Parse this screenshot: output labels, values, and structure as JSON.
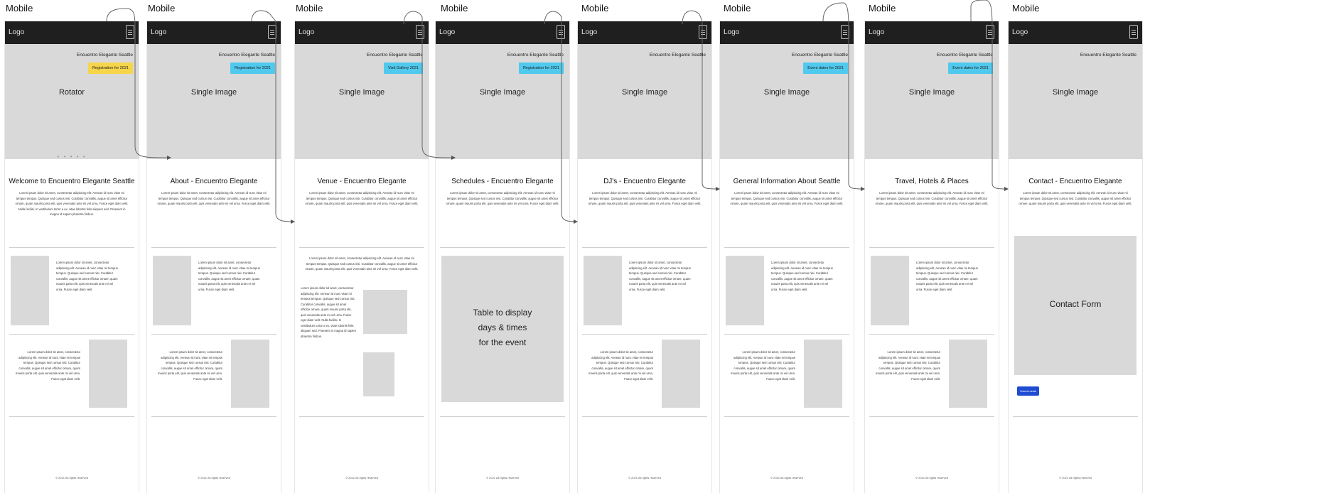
{
  "frame_label": "Mobile",
  "logo": "Logo",
  "hero_title": "Encuentro Elegante Seattle",
  "lorem_short": "Lorem ipsum dolor sit amet, consectetur adipiscing elit. Aenean id nunc vitae mi tempus tempus. Quisque sed cursus nisi. Curabitur convallis, augue sit amet efficitur ornare, quam mauris porta elit, quis venenatis ante mi vel urna. Fusce eget diam velit.",
  "lorem_long": "Lorem ipsum dolor sit amet, consectetur adipiscing elit. Aenean id nunc vitae mi tempus tempus. Quisque sed cursus nisi. Curabitur convallis, augue sit amet efficitur ornare, quam mauris porta elit, quis venenatis ante mi vel urna. Fusce eget diam velit. Nulla facilisi. In vestibulum tortor a ex, vitae lobortis felis aliquam sed. Praesent in magna id sapien pharetra finibus.",
  "footer": "© 2021 All rights reserved",
  "frames": [
    {
      "badge": "Registration for 2021",
      "main": "Rotator",
      "dots": "• • • • •",
      "title": "Welcome to Encuentro Elegante Seattle"
    },
    {
      "badge": "Registration for 2021",
      "main": "Single Image",
      "title": "About - Encuentro Elegante"
    },
    {
      "badge": "Visit Gallery 2021",
      "main": "Single Image",
      "title": "Venue - Encuentro Elegante"
    },
    {
      "badge": "Registration for 2021",
      "main": "Single Image",
      "title": "Schedules - Encuentro Elegante",
      "table_lines": [
        "Table to display",
        "days & times",
        "for the event"
      ]
    },
    {
      "badge": "",
      "main": "Single Image",
      "title": "DJ's - Encuentro Elegante"
    },
    {
      "badge": "Event dates for 2021",
      "main": "Single Image",
      "title": "General Information About Seattle"
    },
    {
      "badge": "Event dates for 2021",
      "main": "Single Image",
      "title": "Travel, Hotels & Places"
    },
    {
      "badge": "",
      "main": "Single Image",
      "title": "Contact - Encuentro Elegante",
      "contact_form": "Contact Form",
      "submit": "Submit detail"
    }
  ],
  "colors": {
    "topbar": "#1f1f1f",
    "badge_blue": "#4fc9ee",
    "badge_yellow": "#f6d54b",
    "placeholder": "#d9d9d9",
    "submit": "#1f4bd3"
  }
}
